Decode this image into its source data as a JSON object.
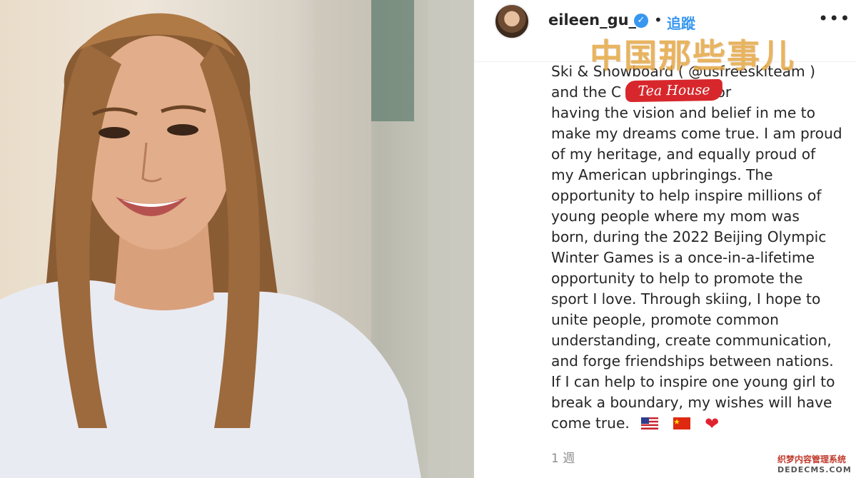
{
  "post": {
    "username": "eileen_gu_",
    "verified_icon": "verified-badge-icon",
    "separator": "•",
    "follow_label": "追蹤",
    "more_label": "•••",
    "caption_lines": [
      "Ski & Snowboard ( @usfreeskiteam )",
      "and the C  association for",
      "having the vision and belief in me to",
      "make my dreams come true. I am proud",
      "of my heritage, and equally proud of",
      "my American upbringings. The",
      "opportunity to help inspire millions of",
      "young people where my mom was",
      "born, during the 2022 Beijing Olympic",
      "Winter Games is a once-in-a-lifetime",
      "opportunity to help to promote the",
      "sport I love. Through skiing, I hope to",
      "unite people, promote common",
      "understanding, create communication,",
      "and forge friendships between nations.",
      "If I can help to inspire one young girl to",
      "break a boundary, my wishes will have"
    ],
    "last_line_text": "come true.",
    "emojis": [
      "us-flag-icon",
      "china-flag-icon",
      "red-heart-icon"
    ],
    "heart_glyph": "❤",
    "timestamp": "1 週"
  },
  "overlays": {
    "channel_title": "中国那些事儿",
    "channel_badge": "Tea House",
    "corner_line1": "织梦内容管理系统",
    "corner_line2": "DEDECMS.COM"
  },
  "colors": {
    "link_blue": "#3897f0",
    "text": "#262626",
    "muted": "#8e8e8e",
    "badge_red": "#d7272c"
  }
}
